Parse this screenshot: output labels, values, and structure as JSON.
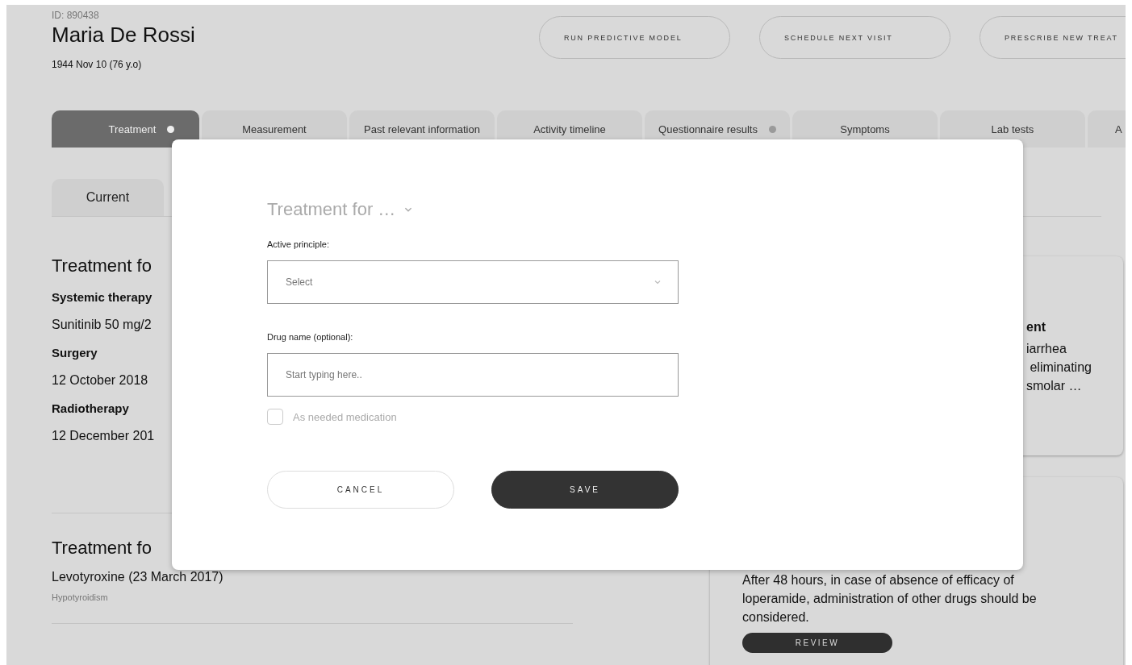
{
  "patient": {
    "id_label": "ID: 890438",
    "name": "Maria De Rossi",
    "birth": "1944 Nov 10 (76 y.o)"
  },
  "actions": [
    "RUN PREDICTIVE MODEL",
    "SCHEDULE NEXT VISIT",
    "PRESCRIBE NEW TREAT"
  ],
  "tabs": [
    {
      "label": "Treatment",
      "selected": true,
      "dot": true
    },
    {
      "label": "Measurement",
      "selected": false,
      "dot": false
    },
    {
      "label": "Past relevant information",
      "selected": false,
      "dot": false
    },
    {
      "label": "Activity timeline",
      "selected": false,
      "dot": false
    },
    {
      "label": "Questionnaire results",
      "selected": false,
      "dot": true
    },
    {
      "label": "Symptoms",
      "selected": false,
      "dot": false
    },
    {
      "label": "Lab tests",
      "selected": false,
      "dot": false
    },
    {
      "label": "A",
      "selected": false,
      "dot": false
    }
  ],
  "subtabs": [
    {
      "label": "Current",
      "selected": true
    }
  ],
  "sections": [
    {
      "heading": "Treatment fo",
      "items": [
        {
          "kind": "label",
          "text": "Systemic therapy"
        },
        {
          "kind": "value",
          "text": "Sunitinib 50 mg/2"
        },
        {
          "kind": "label",
          "text": "Surgery"
        },
        {
          "kind": "value",
          "text": "12 October 2018"
        },
        {
          "kind": "label",
          "text": "Radiotherapy"
        },
        {
          "kind": "value",
          "text": "12 December 201"
        }
      ]
    },
    {
      "heading": "Treatment fo",
      "items": [
        {
          "kind": "value",
          "text": "Levotyroxine (23 March 2017)"
        },
        {
          "kind": "note",
          "text": "Hypotyroidism"
        }
      ]
    }
  ],
  "cards": [
    {
      "lines": [
        {
          "kind": "title",
          "text": "ent"
        },
        {
          "kind": "body",
          "text": "iarrhea"
        },
        {
          "kind": "body",
          "text": " eliminating"
        },
        {
          "kind": "body",
          "text": "smolar …"
        }
      ]
    },
    {
      "lines": [
        {
          "kind": "body",
          "text": "After 48 hours, in case of absence of efficacy of loperamide, administration of other drugs should be considered."
        }
      ],
      "button": "REVIEW"
    }
  ],
  "modal": {
    "title": "Treatment for …",
    "fields": [
      {
        "kind": "select",
        "label": "Active principle:",
        "placeholder": "Select"
      },
      {
        "kind": "text",
        "label": "Drug name (optional):",
        "placeholder": "Start typing here.."
      }
    ],
    "checkbox": {
      "label": "As needed medication",
      "checked": false
    },
    "buttons": [
      {
        "kind": "secondary",
        "label": "CANCEL"
      },
      {
        "kind": "primary",
        "label": "SAVE"
      }
    ]
  }
}
